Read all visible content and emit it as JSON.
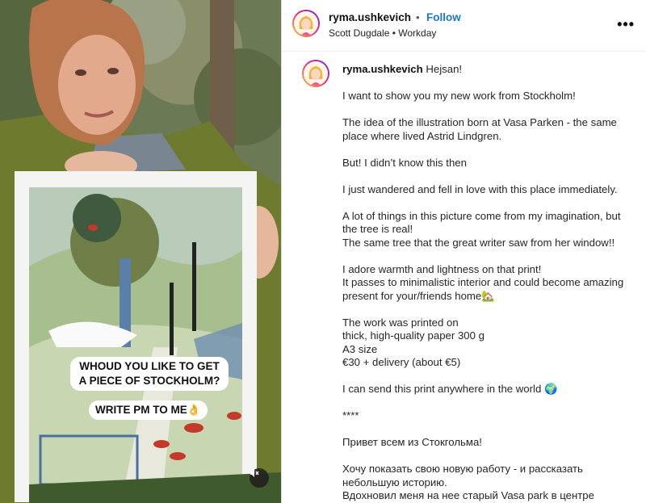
{
  "media": {
    "caption_line1": "WHOUD YOU LIKE TO GET A PIECE OF STOCKHOLM?",
    "caption_line2": "WRITE PM TO ME👌",
    "mute_icon": "mute-icon"
  },
  "header": {
    "username": "ryma.ushkevich",
    "separator": "•",
    "follow_label": "Follow",
    "subline": "Scott Dugdale • Workday",
    "more_icon": "more-options-icon",
    "more_label": "•••"
  },
  "post": {
    "username": "ryma.ushkevich",
    "text": "Hejsan!\n\nI want to show you my new work from Stockholm!\n\nThe idea of the illustration born at Vasa Parken - the same place where lived Astrid Lindgren.\n\nBut! I didn’t know this then\n\nI just wandered and fell in love with this place immediately.\n\nA lot of things in this picture come from my imagination, but the tree is real!\nThe same tree that the great writer saw from her window!!\n\nI adore warmth and lightness on that print!\nIt passes to minimalistic interior and could become amazing present for your/friends home🏡\n\nThe work was printed on\nthick, high-quality paper 300 g\nA3 size\n€30 + delivery (about €5)\n\nI can send this print anywhere in the world 🌍\n\n****\n\nПривет всем из Стокгольма!\n\nХочу показать свою новую работу - и рассказать небольшую историю.\nВдохновил меня на нее старый Vasa park в центре"
  }
}
